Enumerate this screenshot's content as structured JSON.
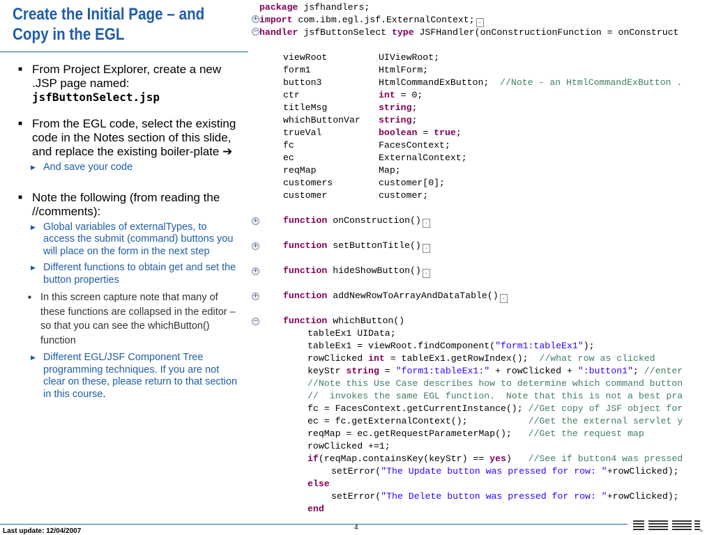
{
  "slide": {
    "title_line1": "Create the Initial Page – and",
    "title_line2": "Copy in the EGL",
    "footer_update": "Last update: 12/04/2007",
    "page_number": "4",
    "logo_text": "IBM"
  },
  "bullets": {
    "b1_text": "From Project Explorer, create a new .JSP page named:",
    "b1_file": "jsfButtonSelect.jsp",
    "b2_text": "From the EGL code, select the existing code in the Notes section of this slide, and replace the existing boiler-plate ",
    "b2_arrow": "➔",
    "b2_sub1": "And save your code",
    "b3_text": "Note the following (from reading the //comments):",
    "b3_sub1": "Global variables of externalTypes, to access the submit (command) buttons you will place on the form in the next step",
    "b3_sub2": "Different functions to obtain get and set the button properties",
    "b3_sub2_sub1": "In this screen capture note that many of these functions are collapsed in the editor – so that you can see the whichButton() function",
    "b3_sub3": "Different EGL/JSF Component Tree programming techniques.  If you are not clear on these, please return to that section in this course",
    "b3_sub3_period": "."
  },
  "code": {
    "line1_kw": "package",
    "line1_rest": " jsfhandlers;",
    "line2_kw": "import",
    "line2_rest": " com.ibm.egl.jsf.ExternalContext;",
    "line3_kw1": "handler",
    "line3_mid": " jsfButtonSelect ",
    "line3_kw2": "type",
    "line3_rest": " JSFHandler(onConstructionFunction = onConstruct",
    "decls": [
      {
        "name": "viewRoot",
        "type": "UIViewRoot;"
      },
      {
        "name": "form1",
        "type": "HtmlForm;"
      },
      {
        "name": "button3",
        "type": "HtmlCommandExButton;",
        "comment": "//Note - an HtmlCommandExButton ."
      },
      {
        "name": "ctr",
        "type": "int",
        "rest": " = 0;"
      },
      {
        "name": "titleMsg",
        "type": "string",
        "rest": ";"
      },
      {
        "name": "whichButtonVar",
        "type": "string",
        "rest": ";"
      },
      {
        "name": "trueVal",
        "type": "boolean",
        "rest": " = ",
        "kw2": "true",
        "rest2": ";"
      },
      {
        "name": "fc",
        "type": "FacesContext;"
      },
      {
        "name": "ec",
        "type": "ExternalContext;"
      },
      {
        "name": "reqMap",
        "type": "Map;"
      },
      {
        "name": "customers",
        "type": "customer[0];"
      },
      {
        "name": "customer",
        "type": "customer;"
      }
    ],
    "function_kw": "function",
    "fn1": " onConstruction()",
    "fn2": " setButtonTitle()",
    "fn3": " hideShowButton()",
    "fn4": " addNewRowToArrayAndDataTable()",
    "fn5": " whichButton()",
    "body1": "tableEx1 UIData;",
    "body2_a": "tableEx1 = viewRoot.findComponent(",
    "body2_s": "\"form1:tableEx1\"",
    "body2_b": ");",
    "body3_a": "rowClicked ",
    "body3_kw": "int",
    "body3_b": " = tableEx1.getRowIndex();  ",
    "body3_c": "//what row as clicked",
    "body4_a": "keyStr ",
    "body4_kw": "string",
    "body4_b": " = ",
    "body4_s1": "\"form1:tableEx1:\"",
    "body4_c": " + rowClicked + ",
    "body4_s2": "\":button1\"",
    "body4_d": "; ",
    "body4_cm": "//enter",
    "body5_cm": "//Note this Use Case describes how to determine which command button",
    "body6_cm": "//  invokes the same EGL function.  Note that this is not a best pra",
    "body7_a": "fc = FacesContext.getCurrentInstance(); ",
    "body7_cm": "//Get copy of JSF object for",
    "body8_a": "ec = fc.getExternalContext();           ",
    "body8_cm": "//Get the external servlet y",
    "body9_a": "reqMap = ec.getRequestParameterMap();   ",
    "body9_cm": "//Get the request map",
    "body10": "rowClicked +=1;",
    "body11_kw": "if",
    "body11_a": "(reqMap.containsKey(keyStr) == ",
    "body11_kw2": "yes",
    "body11_b": ")   ",
    "body11_cm": "//See if button4 was pressed",
    "body12_a": "setError(",
    "body12_s": "\"The Update button was pressed for row: \"",
    "body12_b": "+rowClicked);",
    "body13_kw": "else",
    "body14_a": "setError(",
    "body14_s": "\"The Delete button was pressed for row: \"",
    "body14_b": "+rowClicked);",
    "body15_kw": "end"
  },
  "colors": {
    "title_blue": "#1f5da8",
    "keyword": "#7f0055",
    "comment": "#3f7f5f",
    "string": "#2a00ff"
  },
  "icons": {
    "bullet_l1": "square-bullet-icon",
    "bullet_l2": "triangle-bullet-icon",
    "bullet_l3": "small-square-bullet-icon",
    "gutter_expand": "plus-circle-icon",
    "gutter_collapse": "minus-circle-icon",
    "fold_marker": "collapsed-code-marker-icon",
    "logo": "ibm-logo-icon"
  }
}
